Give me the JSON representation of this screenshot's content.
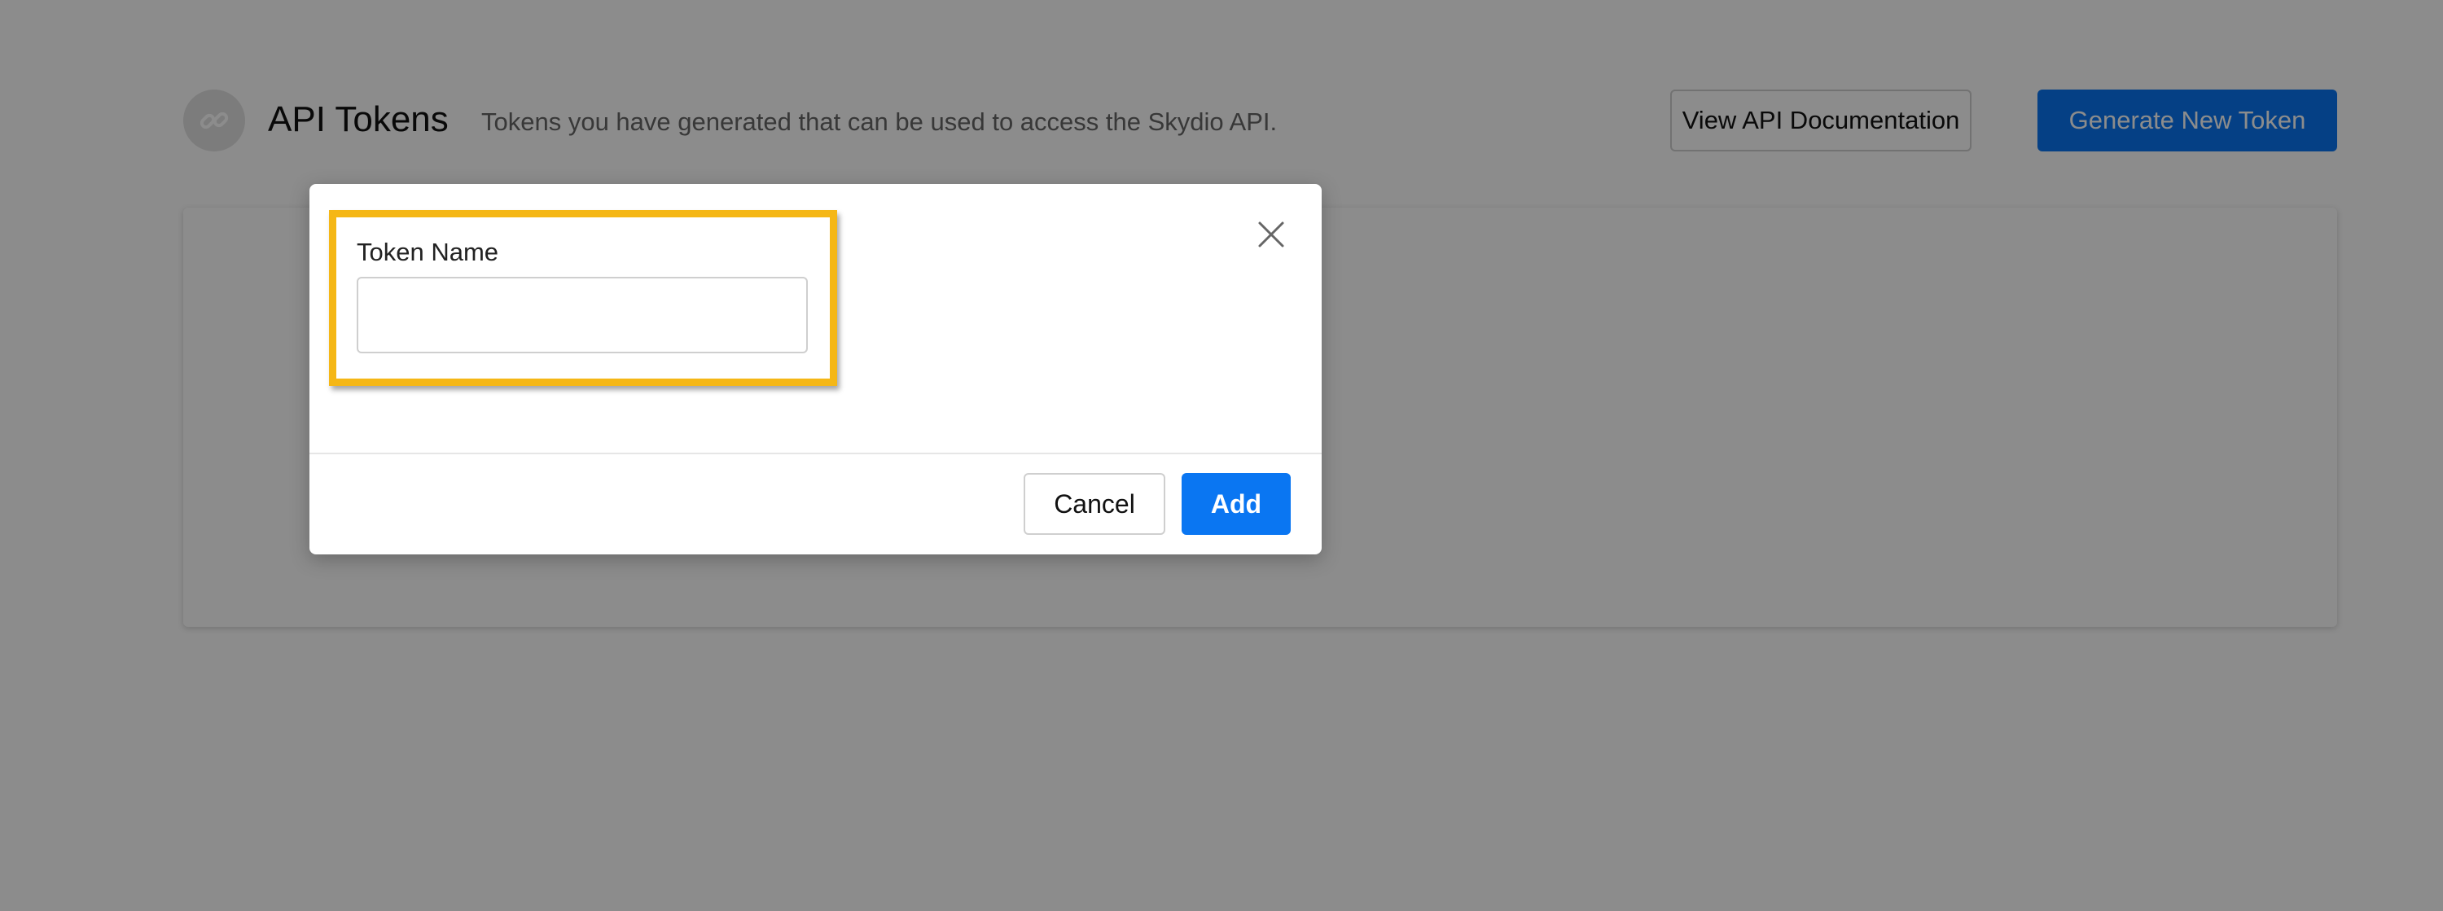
{
  "header": {
    "title": "API Tokens",
    "subtitle": "Tokens you have generated that can be used to access the Skydio API.",
    "icon": "link-icon",
    "docs_button_label": "View API Documentation",
    "generate_button_label": "Generate New Token"
  },
  "modal": {
    "field_label": "Token Name",
    "field_value": "",
    "field_placeholder": "",
    "close_icon": "close-icon",
    "cancel_label": "Cancel",
    "add_label": "Add"
  },
  "colors": {
    "primary": "#0a76f2",
    "highlight": "#f5b716",
    "overlay": "rgba(0,0,0,0.45)"
  }
}
